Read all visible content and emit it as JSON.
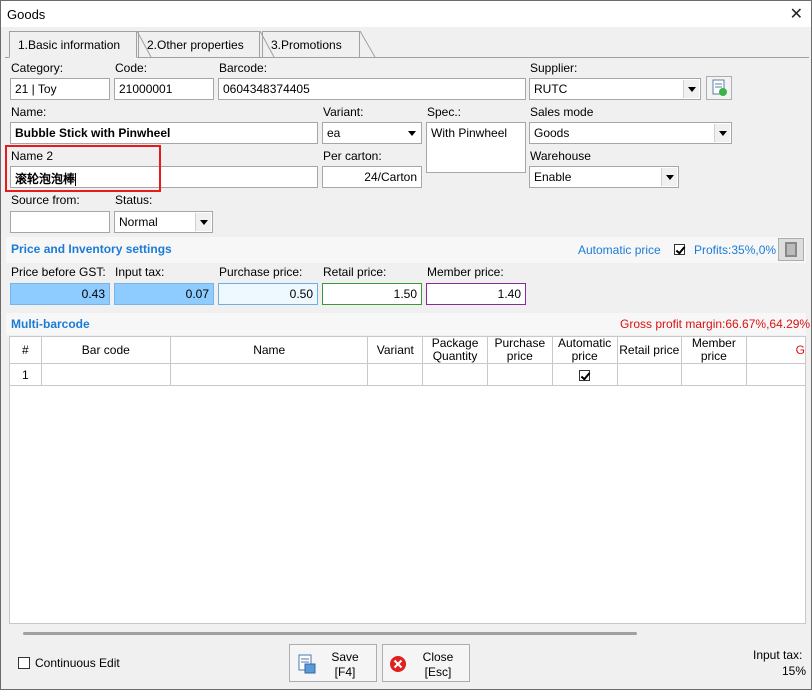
{
  "window": {
    "title": "Goods",
    "close_glyph": "✕"
  },
  "tabs": [
    {
      "label": "1.Basic information"
    },
    {
      "label": "2.Other properties"
    },
    {
      "label": "3.Promotions"
    }
  ],
  "form": {
    "category_label": "Category:",
    "category_value": "21 | Toy",
    "code_label": "Code:",
    "code_value": "21000001",
    "barcode_label": "Barcode:",
    "barcode_value": "0604348374405",
    "supplier_label": "Supplier:",
    "supplier_value": "RUTC",
    "name_label": "Name:",
    "name_value": "Bubble Stick with Pinwheel",
    "variant_label": "Variant:",
    "variant_value": "ea",
    "spec_label": "Spec.:",
    "spec_value": "With Pinwheel",
    "sales_mode_label": "Sales mode",
    "sales_mode_value": "Goods",
    "name2_label": "Name 2",
    "name2_value": "滚轮泡泡棒",
    "per_carton_label": "Per carton:",
    "per_carton_value": "24/Carton",
    "warehouse_label": "Warehouse",
    "warehouse_value": "Enable",
    "source_label": "Source from:",
    "source_value": "",
    "status_label": "Status:",
    "status_value": "Normal"
  },
  "price": {
    "section_title": "Price and Inventory settings",
    "auto_price_label": "Automatic price",
    "auto_price_checked": true,
    "profits_text": "Profits:35%,0%",
    "before_gst_label": "Price before GST:",
    "before_gst_value": "0.43",
    "input_tax_label": "Input tax:",
    "input_tax_value": "0.07",
    "purchase_label": "Purchase price:",
    "purchase_value": "0.50",
    "retail_label": "Retail price:",
    "retail_value": "1.50",
    "member_label": "Member price:",
    "member_value": "1.40"
  },
  "multi": {
    "section_title": "Multi-barcode",
    "gross_margin": "Gross profit margin:66.67%,64.29%",
    "columns": [
      "#",
      "Bar code",
      "Name",
      "Variant",
      "Package Quantity",
      "Purchase price",
      "Automatic price",
      "Retail price",
      "Member price",
      "G"
    ],
    "rows": [
      {
        "num": "1",
        "auto_checked": true
      }
    ]
  },
  "footer": {
    "continuous_edit_label": "Continuous Edit",
    "save_label": "Save",
    "save_key": "[F4]",
    "close_label": "Close",
    "close_key": "[Esc]",
    "input_tax_label": "Input tax:",
    "input_tax_value": "15%"
  },
  "colors": {
    "accent_blue": "#1b7cd6",
    "highlight_red": "#e41c1c",
    "price_cell_blue": "#8ecbff",
    "retail_border_green": "#3a9a3a",
    "member_border_purple": "#8a2a9a"
  }
}
